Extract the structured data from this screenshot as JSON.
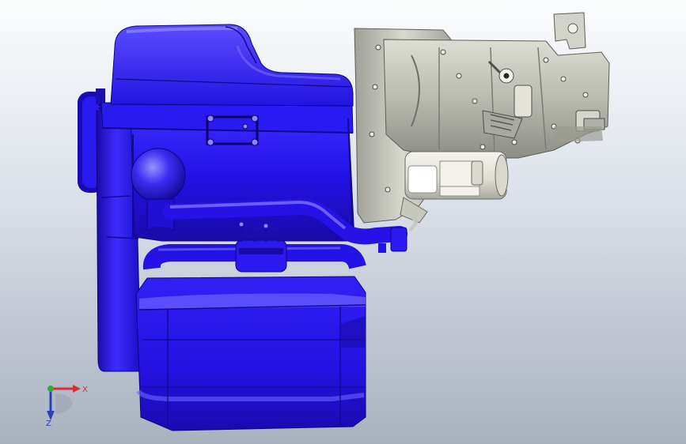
{
  "viewport": {
    "name": "cad-graphics-area",
    "background_top": "#fbfcfd",
    "background_bottom": "#a9b1bf"
  },
  "model": {
    "engine_color": "#2a1af0",
    "engine_shade": "#1c0fb0",
    "engine_highlight": "#8a80ff",
    "gearbox_color": "#c9cac0",
    "gearbox_shade": "#8e8f86",
    "starter_color": "#e9e9df"
  },
  "triad": {
    "x_label": "X",
    "z_label": "Z",
    "x_color": "#d63030",
    "y_color": "#30b030",
    "z_color": "#2d3fb8"
  }
}
